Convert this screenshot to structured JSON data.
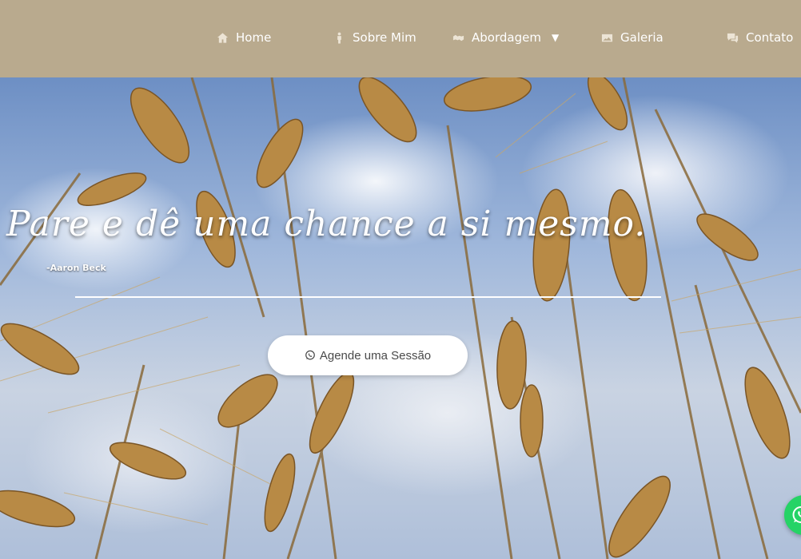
{
  "nav": {
    "items": [
      {
        "label": "Home",
        "icon": "home-icon"
      },
      {
        "label": "Sobre Mim",
        "icon": "person-icon"
      },
      {
        "label": "Abordagem",
        "icon": "handshake-icon",
        "caret": "▼"
      },
      {
        "label": "Galeria",
        "icon": "image-icon"
      },
      {
        "label": "Contato",
        "icon": "chat-icon"
      }
    ]
  },
  "hero": {
    "quote": "Pare e dê uma chance a si mesmo.",
    "author": "-Aaron Beck",
    "cta_label": "Agende uma Sessão",
    "cta_icon": "whatsapp-icon"
  },
  "colors": {
    "header_bg": "#b9aa8e",
    "nav_text": "#ffffff",
    "whatsapp_green": "#25d366"
  }
}
